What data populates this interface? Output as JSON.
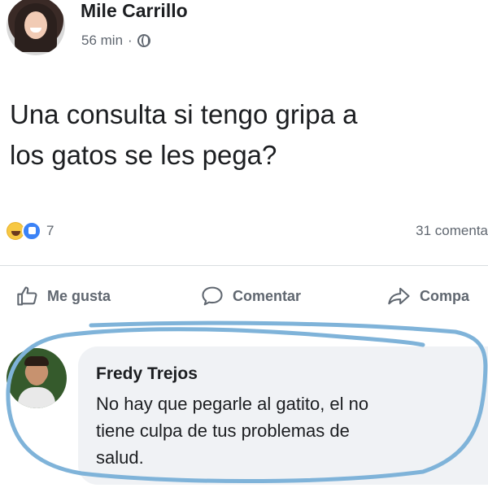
{
  "post": {
    "author": "Mile Carrillo",
    "time": "56 min",
    "separator": "·",
    "text_line1": "Una consulta si tengo gripa a",
    "text_line2": "los gatos se les pega?",
    "reaction_count": "7",
    "comments_count": "31 comenta"
  },
  "actions": {
    "like": "Me gusta",
    "comment": "Comentar",
    "share": "Compa"
  },
  "comment": {
    "author": "Fredy Trejos",
    "line1": "No hay que pegarle al gatito, el no",
    "line2": "tiene culpa de tus problemas de",
    "line3": "salud."
  },
  "icons": {
    "reactions": [
      "haha-icon",
      "like-icon"
    ],
    "privacy": "globe-icon",
    "like_action": "thumbs-up-icon",
    "comment_action": "speech-bubble-icon",
    "share_action": "share-arrow-icon"
  },
  "colors": {
    "highlight_stroke": "#7fb3d9",
    "like_blue": "#3b82f6",
    "haha_yellow": "#f7c843",
    "muted_text": "#606770",
    "bubble_bg": "#f0f2f5"
  }
}
